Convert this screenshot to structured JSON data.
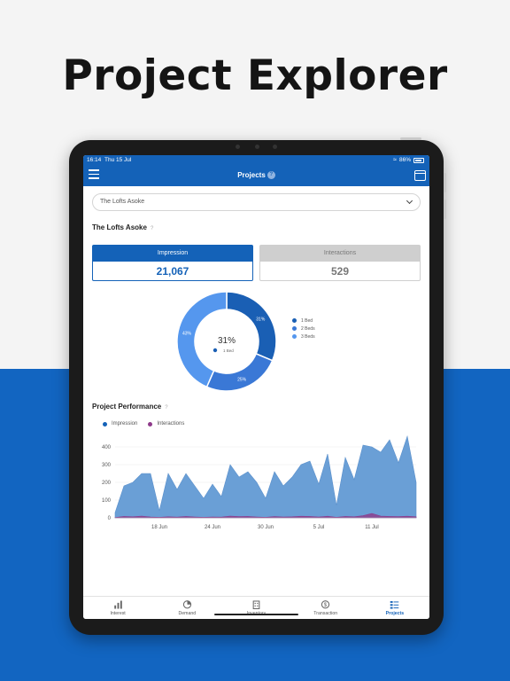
{
  "headline": "Project Explorer",
  "status": {
    "time": "16:14",
    "date": "Thu 15 Jul",
    "battery": "86%"
  },
  "nav": {
    "title": "Projects",
    "help": "?"
  },
  "dropdown": {
    "value": "The Lofts Asoke"
  },
  "project": {
    "title": "The Lofts Asoke",
    "help": "?"
  },
  "kpis": [
    {
      "label": "Impression",
      "value": "21,067",
      "active": true
    },
    {
      "label": "Interactions",
      "value": "529",
      "active": false
    }
  ],
  "colors": {
    "brand": "#1462b8",
    "bed1": "#1a5fb4",
    "bed2": "#3a78d6",
    "bed3": "#5597ee",
    "impression": "#1462b8",
    "interactions": "#8e3a8a",
    "area_fill": "#6a9fd6"
  },
  "chart_data": [
    {
      "type": "pie",
      "categories": [
        "1 Bed",
        "2 Beds",
        "3 Beds"
      ],
      "values": [
        31,
        25,
        43
      ],
      "slice_labels": [
        "31%",
        "25%",
        "43%"
      ],
      "center": {
        "value": "31%",
        "label": "1 Bed"
      },
      "legend": "right"
    },
    {
      "type": "area",
      "title": "Project Performance",
      "help": "?",
      "x_ticks": [
        "18 Jun",
        "24 Jun",
        "30 Jun",
        "5 Jul",
        "11 Jul"
      ],
      "y_ticks": [
        "400",
        "300",
        "200",
        "100",
        "0"
      ],
      "ylim": [
        0,
        460
      ],
      "series": [
        {
          "name": "Impression",
          "values": [
            30,
            180,
            200,
            250,
            250,
            40,
            250,
            160,
            250,
            180,
            110,
            190,
            120,
            300,
            230,
            260,
            200,
            110,
            260,
            180,
            230,
            300,
            320,
            190,
            360,
            70,
            340,
            215,
            410,
            400,
            370,
            440,
            310,
            460,
            200
          ]
        },
        {
          "name": "Interactions",
          "values": [
            2,
            8,
            6,
            10,
            5,
            3,
            6,
            4,
            8,
            5,
            3,
            5,
            4,
            10,
            7,
            8,
            5,
            3,
            7,
            5,
            6,
            9,
            8,
            5,
            9,
            3,
            8,
            6,
            12,
            25,
            10,
            8,
            7,
            9,
            6
          ]
        }
      ],
      "legend": "top-left",
      "grid": true
    }
  ],
  "tabs": [
    {
      "label": "Interest",
      "icon": "bar-chart-icon",
      "active": false
    },
    {
      "label": "Demand",
      "icon": "pie-chart-icon",
      "active": false
    },
    {
      "label": "Inventory",
      "icon": "building-icon",
      "active": false
    },
    {
      "label": "Transaction",
      "icon": "dollar-icon",
      "active": false
    },
    {
      "label": "Projects",
      "icon": "list-icon",
      "active": true
    }
  ]
}
